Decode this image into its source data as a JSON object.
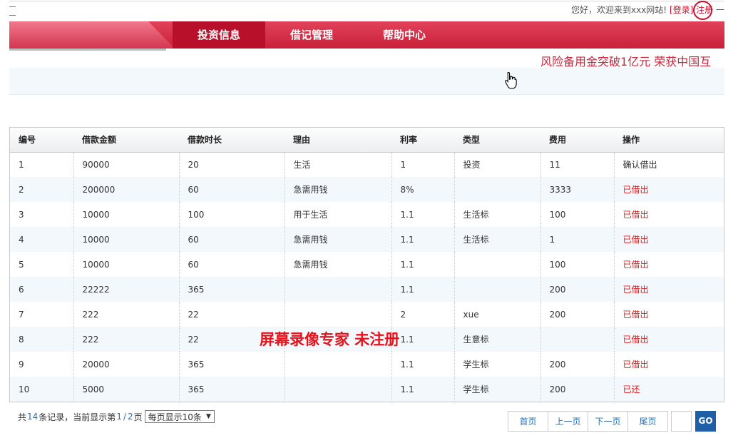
{
  "topbar": {
    "greeting": "您好，欢迎来到xxx网站!",
    "login_link": "[登录]",
    "register_link": "注册",
    "dash": "一"
  },
  "nav": {
    "items": [
      {
        "label": "投资信息",
        "active": true
      },
      {
        "label": "借记管理",
        "active": false
      },
      {
        "label": "帮助中心",
        "active": false
      }
    ]
  },
  "marquee": "风险备用金突破1亿元  荣获中国互",
  "table": {
    "headers": [
      "编号",
      "借款金额",
      "借款时长",
      "理由",
      "利率",
      "类型",
      "费用",
      "操作"
    ],
    "rows": [
      [
        "1",
        "90000",
        "20",
        "生活",
        "1",
        "投资",
        "11",
        "确认借出"
      ],
      [
        "2",
        "200000",
        "60",
        "急需用钱",
        "8%",
        "",
        "3333",
        "已借出"
      ],
      [
        "3",
        "10000",
        "100",
        "用于生活",
        "1.1",
        "生活标",
        "100",
        "已借出"
      ],
      [
        "4",
        "10000",
        "60",
        "急需用钱",
        "1.1",
        "生活标",
        "1",
        "已借出"
      ],
      [
        "5",
        "10000",
        "60",
        "急需用钱",
        "1.1",
        "",
        "100",
        "已借出"
      ],
      [
        "6",
        "22222",
        "365",
        "",
        "1.1",
        "",
        "200",
        "已借出"
      ],
      [
        "7",
        "222",
        "22",
        "",
        "2",
        "xue",
        "200",
        "已借出"
      ],
      [
        "8",
        "222",
        "22",
        "",
        "1.1",
        "生意标",
        "",
        "已借出"
      ],
      [
        "9",
        "20000",
        "365",
        "",
        "1.1",
        "学生标",
        "200",
        "已借出"
      ],
      [
        "10",
        "5000",
        "365",
        "",
        "1.1",
        "学生标",
        "200",
        "已还"
      ]
    ]
  },
  "watermark": "屏幕录像专家  未注册",
  "footer": {
    "prefix": "共",
    "total": "14",
    "mid": "条记录，当前显示第",
    "current": "1",
    "slash": "/",
    "pages": "2",
    "suffix": "页",
    "page_size_label": "每页显示10条"
  },
  "pager": {
    "first": "首页",
    "prev": "上一页",
    "next": "下一页",
    "last": "尾页",
    "go": "GO"
  },
  "colors": {
    "brand_red": "#c9213a",
    "link_red": "#c8102e",
    "link_blue": "#2a6fb5",
    "go_blue": "#1f5fa8"
  }
}
